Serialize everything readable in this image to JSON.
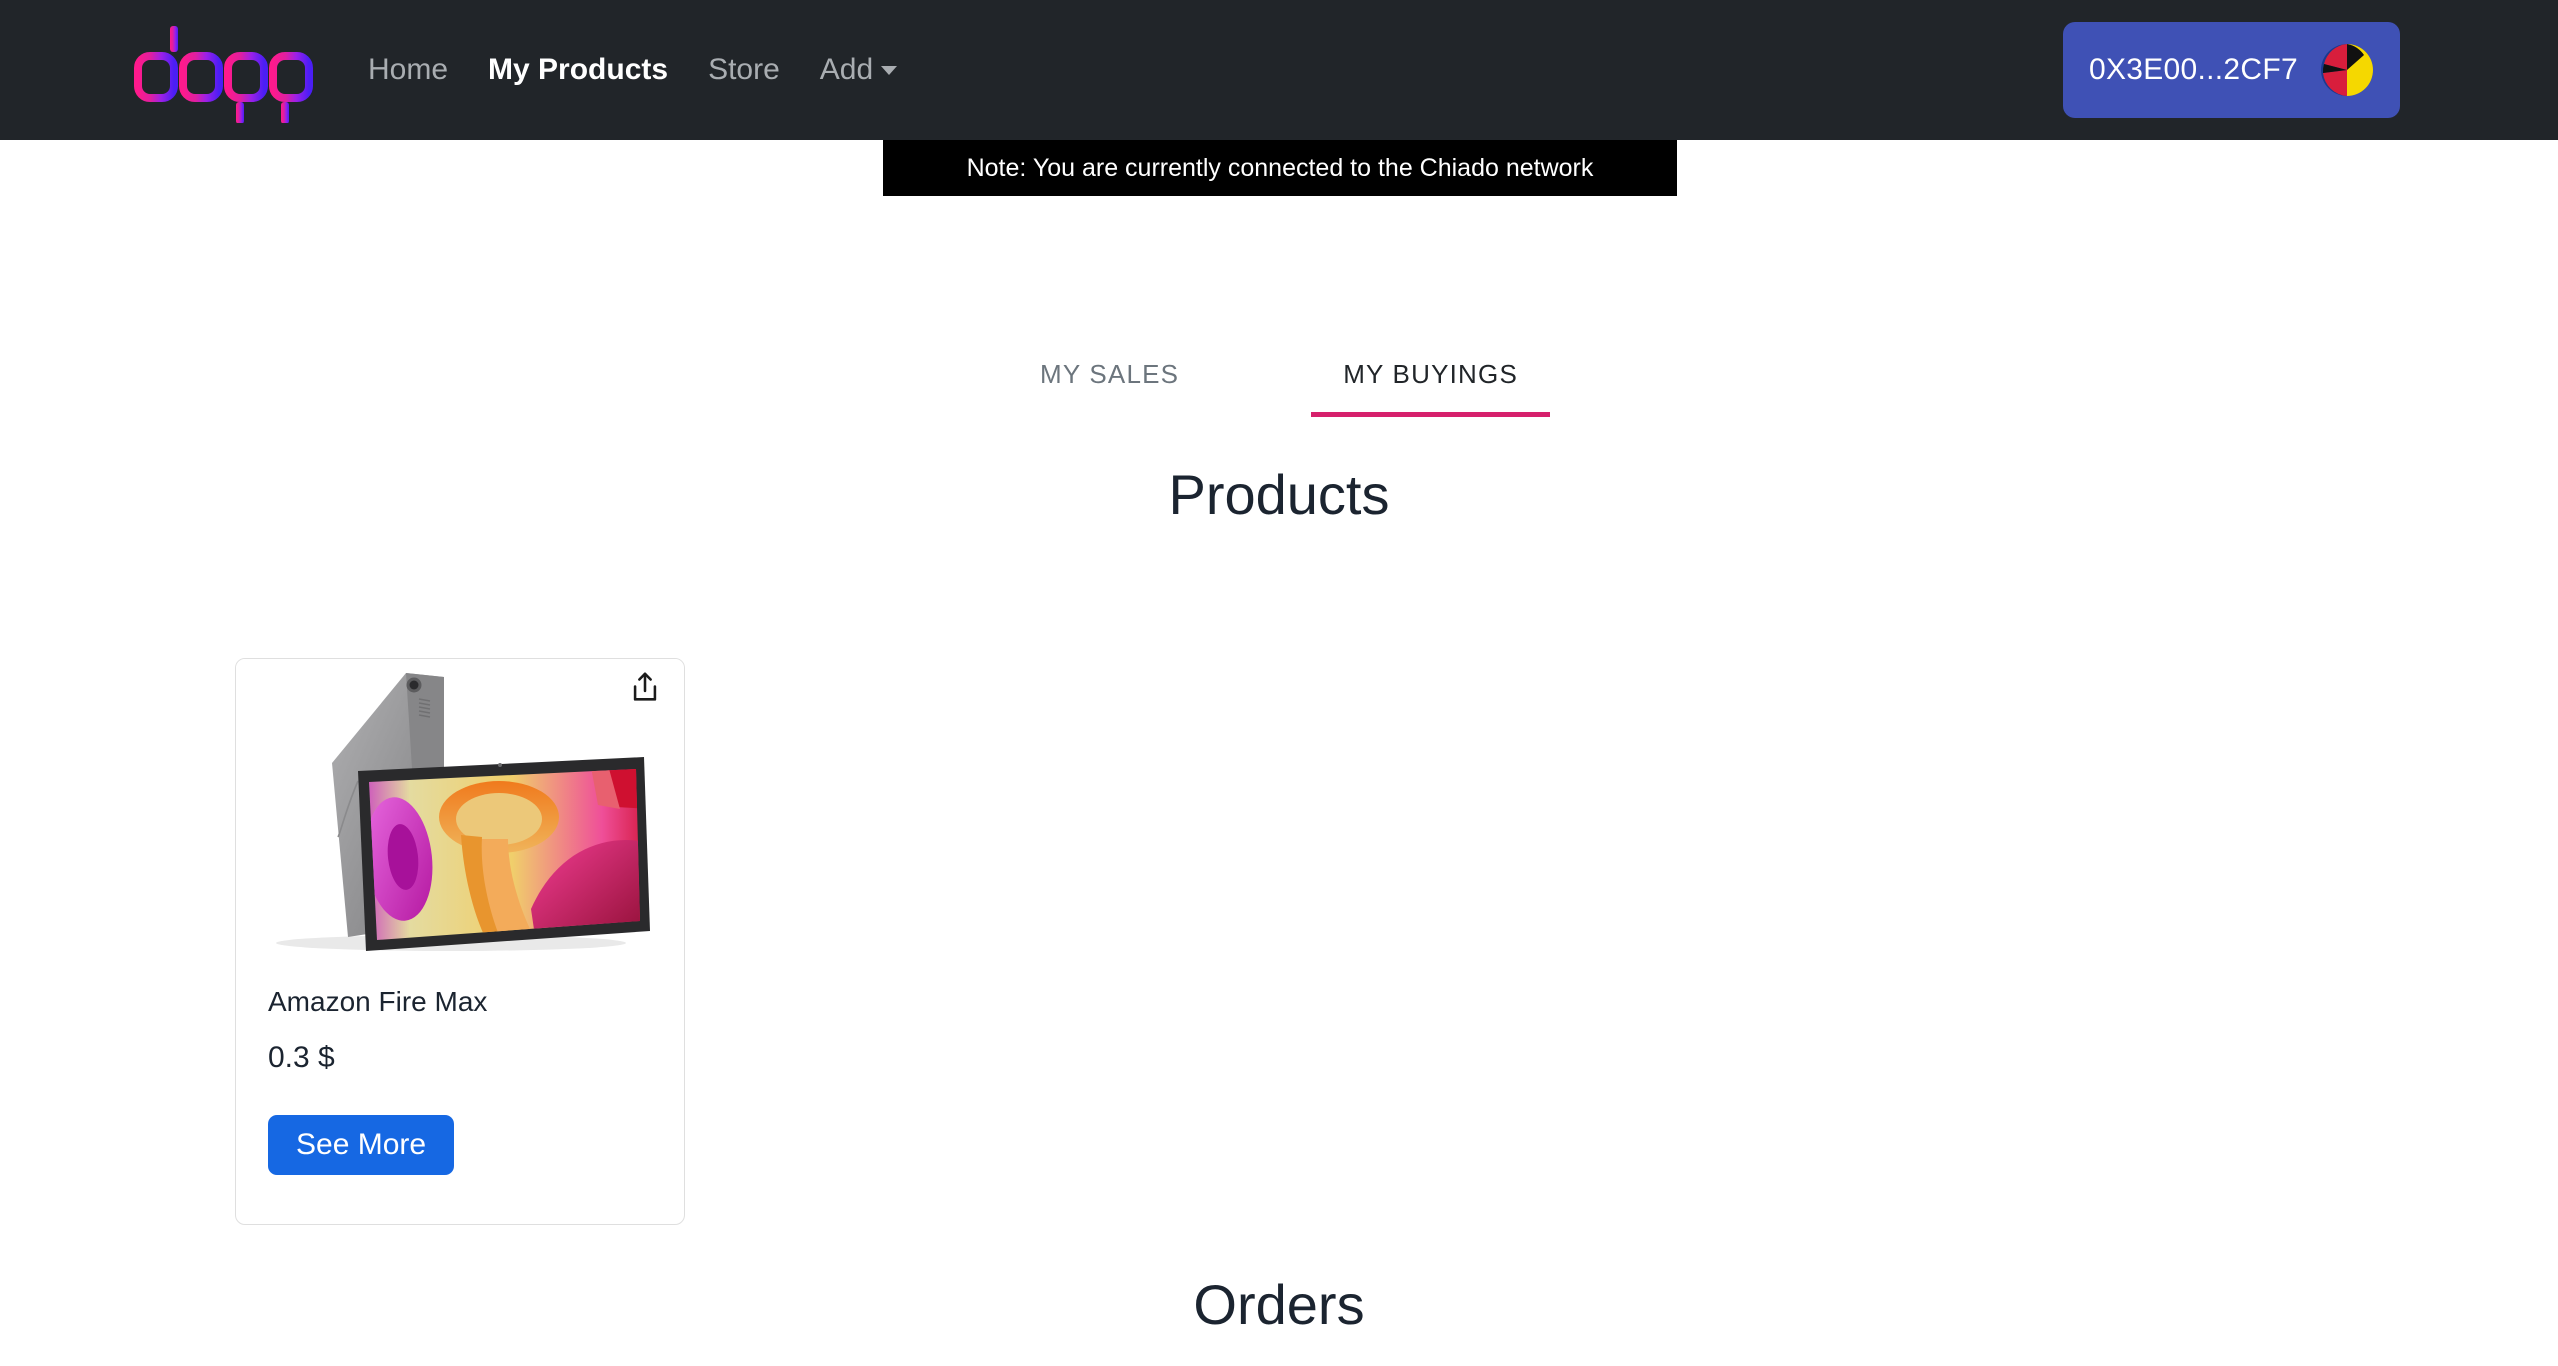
{
  "navbar": {
    "brand_alt": "dapp-logo",
    "links": [
      {
        "label": "Home",
        "active": false
      },
      {
        "label": "My Products",
        "active": true
      },
      {
        "label": "Store",
        "active": false
      }
    ],
    "dropdown": {
      "label": "Add",
      "caret": "chevron-down-icon"
    },
    "wallet": {
      "address": "0X3E00...2CF7",
      "bg_color": "#3f51b5",
      "avatar_alt": "wallet-avatar-blockie"
    },
    "bg_color": "#212529"
  },
  "notice": {
    "text": "Note: You are currently connected to the Chiado network",
    "bg_color": "#000000",
    "text_color": "#ffffff"
  },
  "tabs": {
    "items": [
      {
        "label": "MY SALES",
        "active": false
      },
      {
        "label": "MY BUYINGS",
        "active": true
      }
    ],
    "active_underline_color": "#d6206c"
  },
  "sections": {
    "products_title": "Products",
    "orders_title": "Orders"
  },
  "products": [
    {
      "name": "Amazon Fire Max",
      "price": "0.3 $",
      "button_label": "See More",
      "button_color": "#1668e3",
      "share_icon": "share-icon",
      "image_alt": "amazon-fire-max-tablet"
    }
  ]
}
